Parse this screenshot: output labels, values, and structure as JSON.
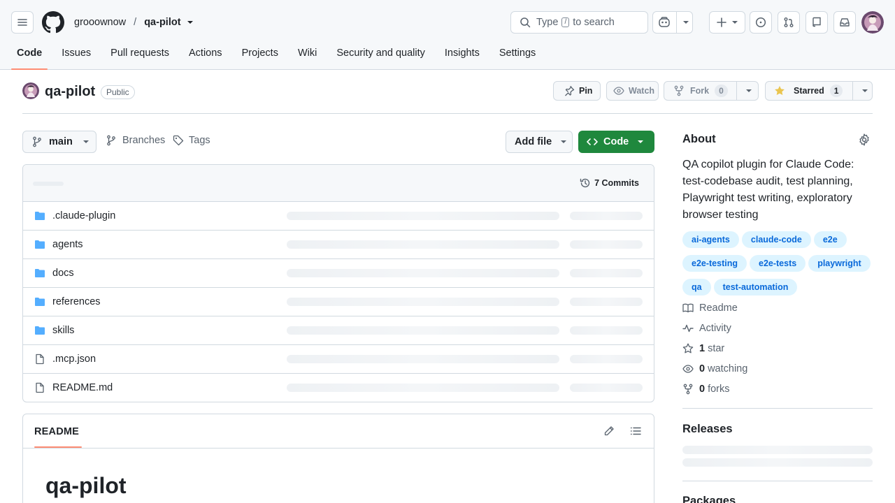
{
  "header": {
    "owner": "grooownow",
    "separator": "/",
    "repo": "qa-pilot",
    "search": {
      "prefix": "Type",
      "key": "/",
      "suffix": "to search"
    }
  },
  "nav": {
    "tabs": [
      {
        "label": "Code"
      },
      {
        "label": "Issues"
      },
      {
        "label": "Pull requests"
      },
      {
        "label": "Actions"
      },
      {
        "label": "Projects"
      },
      {
        "label": "Wiki"
      },
      {
        "label": "Security and quality"
      },
      {
        "label": "Insights"
      },
      {
        "label": "Settings"
      }
    ]
  },
  "repo": {
    "name": "qa-pilot",
    "visibility": "Public",
    "pin_label": "Pin",
    "watch_label": "Watch",
    "fork_label": "Fork",
    "fork_count": "0",
    "star_label": "Starred",
    "star_count": "1"
  },
  "toolbar": {
    "branch": "main",
    "branches_label": "Branches",
    "tags_label": "Tags",
    "add_file_label": "Add file",
    "code_label": "Code"
  },
  "files": {
    "commits_label": "7 Commits",
    "rows": [
      {
        "name": ".claude-plugin",
        "type": "folder"
      },
      {
        "name": "agents",
        "type": "folder"
      },
      {
        "name": "docs",
        "type": "folder"
      },
      {
        "name": "references",
        "type": "folder"
      },
      {
        "name": "skills",
        "type": "folder"
      },
      {
        "name": ".mcp.json",
        "type": "file"
      },
      {
        "name": "README.md",
        "type": "file"
      }
    ]
  },
  "readme": {
    "tab_label": "README",
    "heading": "qa-pilot"
  },
  "about": {
    "heading": "About",
    "description": "QA copilot plugin for Claude Code: test-codebase audit, test planning, Playwright test writing, exploratory browser testing",
    "topics": [
      "ai-agents",
      "claude-code",
      "e2e",
      "e2e-testing",
      "e2e-tests",
      "playwright",
      "qa",
      "test-automation"
    ],
    "readme_link": "Readme",
    "activity_link": "Activity",
    "stars_count": "1",
    "stars_label": "star",
    "watching_count": "0",
    "watching_label": "watching",
    "forks_count": "0",
    "forks_label": "forks"
  },
  "sidebar": {
    "releases_heading": "Releases",
    "packages_heading": "Packages"
  },
  "colors": {
    "accent_green": "#1f883d",
    "tab_underline": "#fd8c73",
    "topic_bg": "#ddf4ff",
    "topic_text": "#0969da",
    "folder_icon": "#54aeff",
    "star_icon": "#eac54f"
  }
}
